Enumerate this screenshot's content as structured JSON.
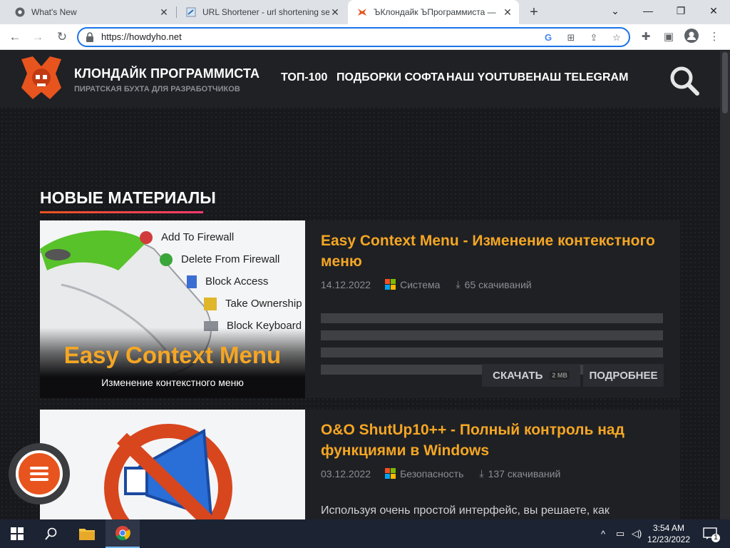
{
  "browser": {
    "tabs": [
      {
        "title": "What's New",
        "active": false
      },
      {
        "title": "URL Shortener - url shortening se",
        "active": false
      },
      {
        "title": "ЪКлондайк ЪПрограммиста — ",
        "active": true
      }
    ],
    "url": "https://howdyho.net"
  },
  "site": {
    "brand": "КЛОНДАЙК ПРОГРАММИСТА",
    "tagline": "ПИРАТСКАЯ БУХТА ДЛЯ РАЗРАБОТЧИКОВ",
    "menu": [
      "ТОП-100",
      "ПОДБОРКИ СОФТА",
      "НАШ YOUTUBE",
      "НАШ TELEGRAM"
    ],
    "section_title": "НОВЫЕ МАТЕРИАЛЫ",
    "articles": [
      {
        "title": "Easy Context Menu - Изменение контекстного меню",
        "date": "14.12.2022",
        "category": "Система",
        "downloads": "65 скачиваний",
        "thumb_title": "Easy Context Menu",
        "thumb_subtitle": "Изменение контекстного меню",
        "thumb_menu": [
          "Add To Firewall",
          "Delete From Firewall",
          "Block Access",
          "Take Ownership",
          "Block Keyboard"
        ],
        "download_label": "СКАЧАТЬ",
        "download_size": "2 MB",
        "more_label": "ПОДРОБНЕЕ"
      },
      {
        "title": "O&O ShutUp10++ - Полный контроль над функциями в Windows",
        "date": "03.12.2022",
        "category": "Безопасность",
        "downloads": "137 скачиваний",
        "description": "Используя очень простой интерфейс, вы решаете, как"
      }
    ]
  },
  "taskbar": {
    "time": "3:54 AM",
    "date": "12/23/2022",
    "notifications": "1"
  },
  "colors": {
    "accent": "#f5a623",
    "brand_red": "#e8541e",
    "chrome_blue": "#1a73e8"
  }
}
